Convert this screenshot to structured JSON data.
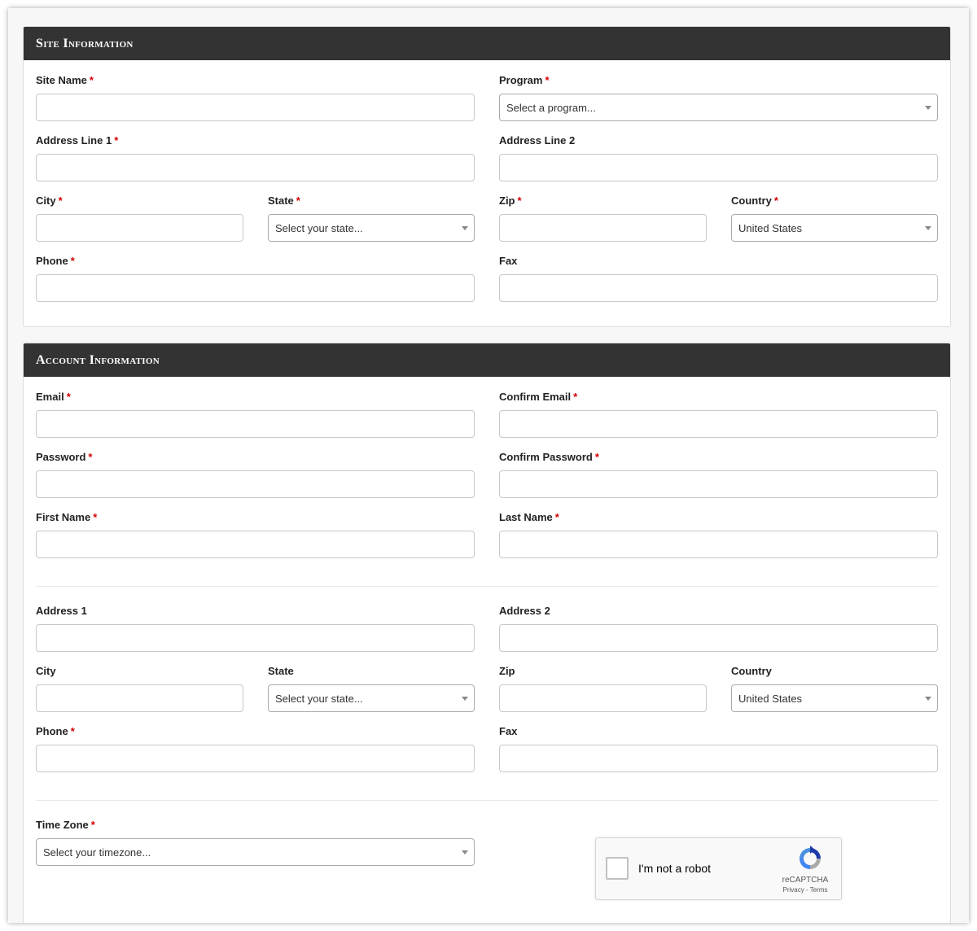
{
  "site_info": {
    "title": "Site Information",
    "site_name_label": "Site Name",
    "program_label": "Program",
    "program_placeholder": "Select a program...",
    "address1_label": "Address Line 1",
    "address2_label": "Address Line 2",
    "city_label": "City",
    "state_label": "State",
    "state_placeholder": "Select your state...",
    "zip_label": "Zip",
    "country_label": "Country",
    "country_value": "United States",
    "phone_label": "Phone",
    "fax_label": "Fax"
  },
  "account_info": {
    "title": "Account Information",
    "email_label": "Email",
    "confirm_email_label": "Confirm Email",
    "password_label": "Password",
    "confirm_password_label": "Confirm Password",
    "first_name_label": "First Name",
    "last_name_label": "Last Name",
    "address1_label": "Address 1",
    "address2_label": "Address 2",
    "city_label": "City",
    "state_label": "State",
    "state_placeholder": "Select your state...",
    "zip_label": "Zip",
    "country_label": "Country",
    "country_value": "United States",
    "phone_label": "Phone",
    "fax_label": "Fax",
    "timezone_label": "Time Zone",
    "timezone_placeholder": "Select your timezone..."
  },
  "required_marker": "*",
  "recaptcha": {
    "label": "I'm not a robot",
    "brand": "reCAPTCHA",
    "links": "Privacy - Terms"
  },
  "colors": {
    "header_bg": "#333333",
    "required": "#d40000"
  }
}
